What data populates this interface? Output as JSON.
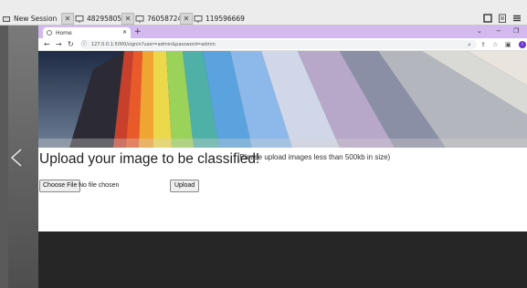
{
  "session_bar": {
    "new_session_label": "New Session",
    "tabs": [
      {
        "label": "482958051"
      },
      {
        "label": "760587241"
      },
      {
        "label": "119596669"
      }
    ]
  },
  "browser": {
    "tab_title": "Home",
    "new_tab": "+",
    "url": "127.0.0.1:5000/signin?user=admin&password=admin",
    "avatar_letter": "I"
  },
  "page": {
    "headline": "Upload your image to be classified!",
    "size_note": "(Please upload images less than 500kb in size)",
    "choose_file_label": "Choose File",
    "file_status": "No file chosen",
    "upload_label": "Upload"
  },
  "colors": {
    "browser_tabstrip": "#d4b8f0",
    "avatar": "#6a35c9",
    "footer": "#262626"
  }
}
